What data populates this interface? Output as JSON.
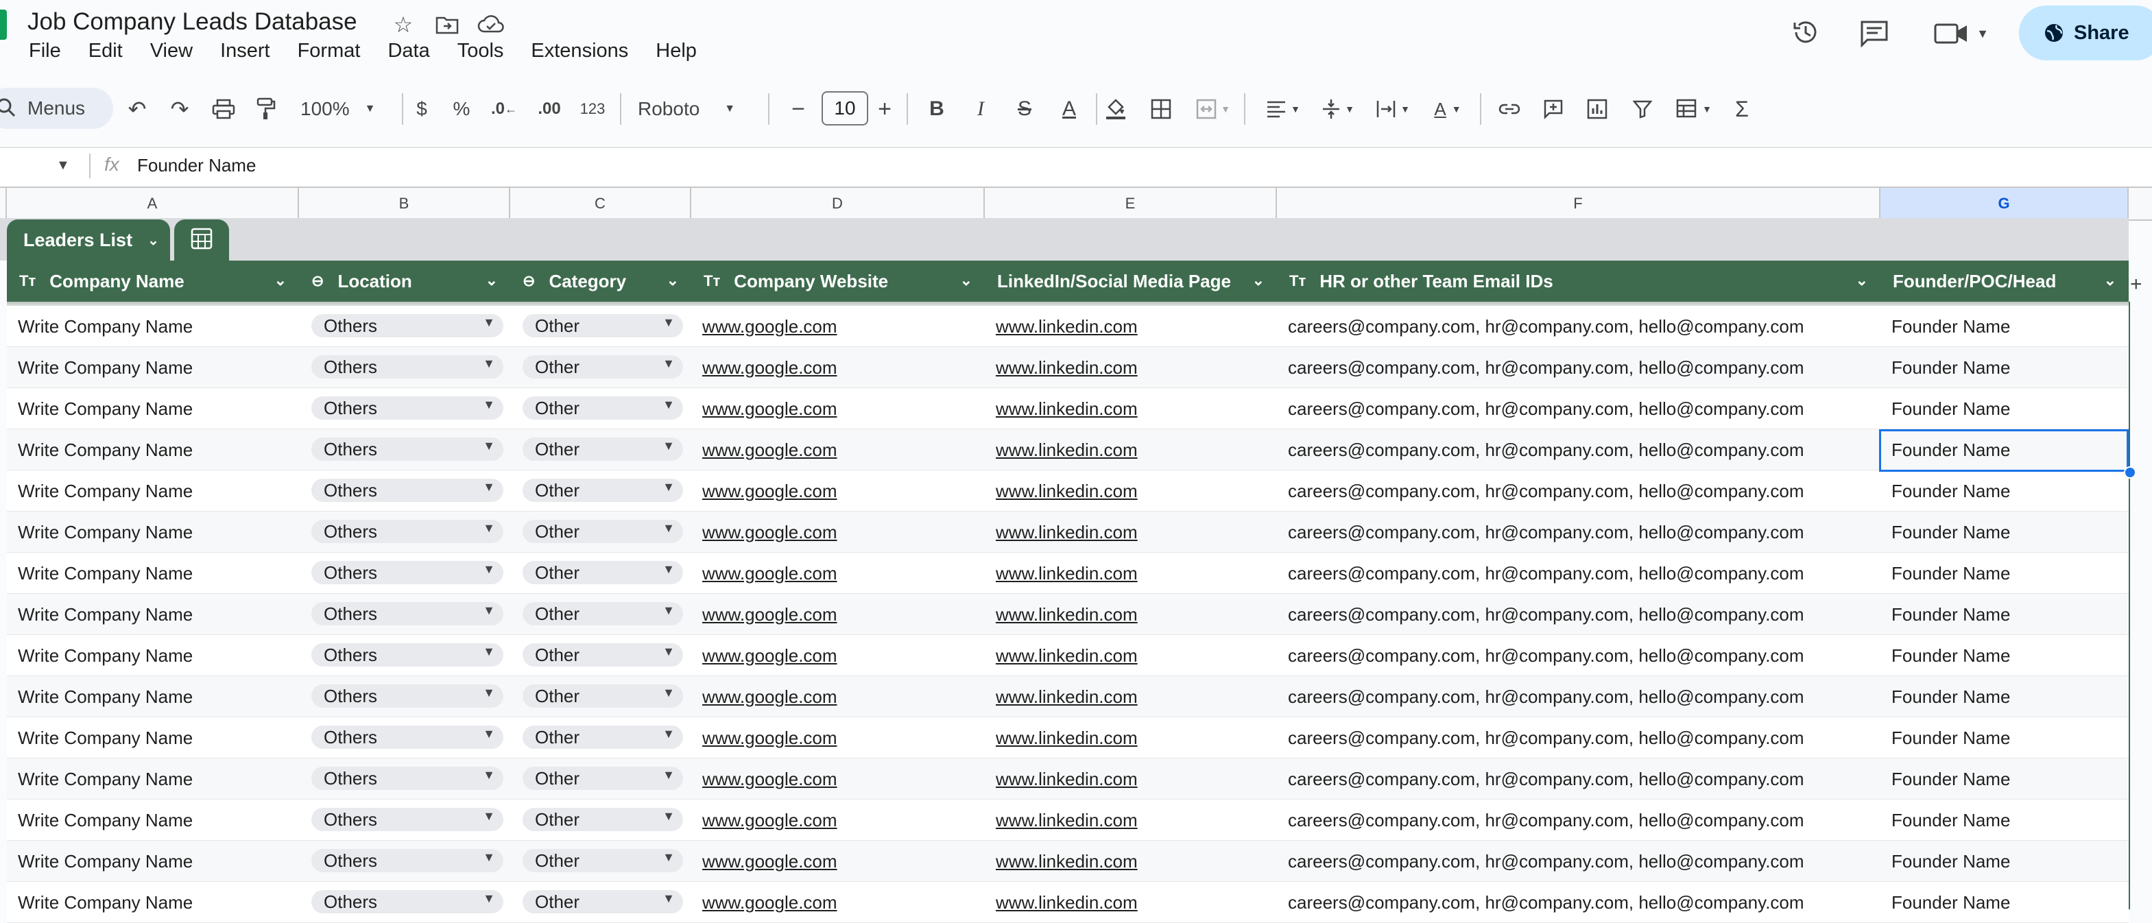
{
  "title": "Job Company Leads Database",
  "menubar": [
    "File",
    "Edit",
    "View",
    "Insert",
    "Format",
    "Data",
    "Tools",
    "Extensions",
    "Help"
  ],
  "share_label": "Share",
  "toolbar": {
    "menus_label": "Menus",
    "zoom": "100%",
    "currency": "$",
    "percent": "%",
    "dec_decrease": ".0",
    "dec_increase": ".00",
    "number_format": "123",
    "font": "Roboto",
    "font_size": "10"
  },
  "formula_bar": {
    "value": "Founder Name"
  },
  "columns": [
    "A",
    "B",
    "C",
    "D",
    "E",
    "F",
    "G"
  ],
  "selected_column": "G",
  "table": {
    "name": "Leaders List",
    "headers": [
      {
        "label": "Company Name",
        "icon": "text-type-icon"
      },
      {
        "label": "Location",
        "icon": "dropdown-chip-icon"
      },
      {
        "label": "Category",
        "icon": "dropdown-chip-icon"
      },
      {
        "label": "Company Website",
        "icon": "text-type-icon"
      },
      {
        "label": "LinkedIn/Social Media Page",
        "icon": ""
      },
      {
        "label": "HR or other Team Email IDs",
        "icon": "text-type-icon"
      },
      {
        "label": "Founder/POC/Head",
        "icon": ""
      }
    ],
    "row": {
      "company": "Write Company Name",
      "location": "Others",
      "category": "Other",
      "website": "www.google.com",
      "linkedin": "www.linkedin.com",
      "emails": "careers@company.com, hr@company.com, hello@company.com",
      "founder": "Founder Name"
    },
    "row_count": 15
  },
  "colors": {
    "table_header": "#3e6b4e",
    "share_bg": "#c2e7ff",
    "selection": "#1a73e8"
  }
}
